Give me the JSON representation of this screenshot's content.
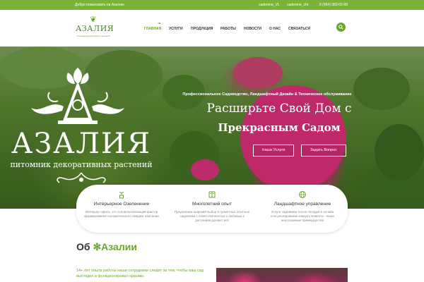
{
  "topbar": {
    "welcome": "Добро пожаловать на Азалию",
    "social": [
      "caderene_VL",
      "caderene_chr"
    ],
    "phone": "8 (964) 060-02-00"
  },
  "header": {
    "logo_name": "АЗАЛИЯ",
    "logo_tagline": "питомник декоративных растений",
    "nav": [
      "ГЛАВНАЯ",
      "УСЛУГИ",
      "ПРОДУКЦИЯ",
      "РАБОТЫ",
      "НОВОСТИ",
      "О НАС",
      "СВЯЗАТЬСЯ"
    ],
    "active_nav": "ГЛАВНАЯ",
    "accent_color": "#6aa532",
    "search_icon": "search-icon"
  },
  "hero": {
    "brand": "АЗАЛИЯ",
    "brand_slogan": "питомник декоративных растений",
    "tagline": "Профессиональное Садоводство, Ландшафтный Дизайн & Техническое обслуживание",
    "heading_line1": "Расширьте Свой Дом с",
    "heading_line2": "Прекрасным Садом",
    "button_services": "Наши Услуги",
    "button_question": "Задать Вопрос"
  },
  "features": [
    {
      "icon": "plant-icon",
      "title": "Интерьерное Озеленение",
      "description": "Интерьер офиса, это основополагающий фактор формирования положительного имиджа компании"
    },
    {
      "icon": "book-icon",
      "title": "Многолетний опыт",
      "description": "Предлагаем широкий выбор в грамотных опытные садовники с ответственностью к любовью к растениям делают всё"
    },
    {
      "icon": "globe-icon",
      "title": "Ландшафтное управление",
      "description": "Услуга садовника после посадки и онлайн консультирование каждого Клиента - наши неоспоримые преимущества"
    }
  ],
  "about": {
    "title_prefix": "Об",
    "title_highlight": "✻Азалии",
    "text": "14+ лет опыта работы наши сотрудники следят за тем, чтобы ваш сад выглядел и функционировал красиво."
  }
}
